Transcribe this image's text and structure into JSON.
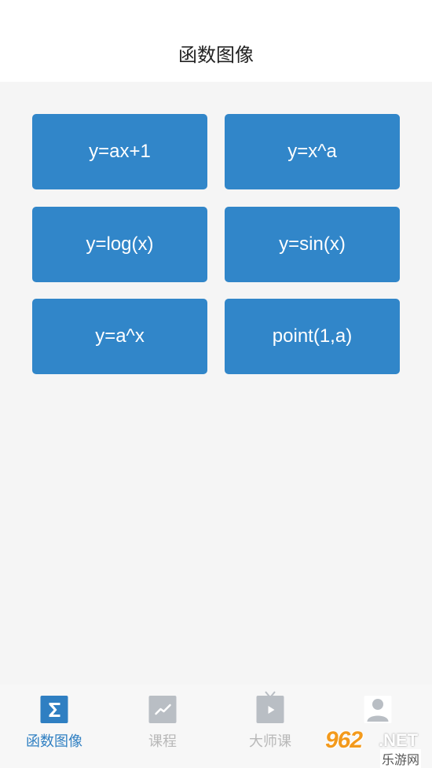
{
  "header": {
    "title": "函数图像"
  },
  "functions": [
    {
      "label": "y=ax+1"
    },
    {
      "label": "y=x^a"
    },
    {
      "label": "y=log(x)"
    },
    {
      "label": "y=sin(x)"
    },
    {
      "label": "y=a^x"
    },
    {
      "label": "point(1,a)"
    }
  ],
  "tabbar": {
    "tabs": [
      {
        "label": "函数图像",
        "icon": "sigma-icon",
        "active": true
      },
      {
        "label": "课程",
        "icon": "chart-icon",
        "active": false
      },
      {
        "label": "大师课",
        "icon": "tv-play-icon",
        "active": false
      },
      {
        "label": "",
        "icon": "user-icon",
        "active": false
      }
    ]
  },
  "watermark": {
    "number": "962",
    "suffix": ".NET",
    "caption": "乐游网"
  },
  "colors": {
    "accent": "#3186c9",
    "tab_active": "#2f7fc2",
    "tab_inactive": "#b8b8b8",
    "background": "#f5f5f5"
  }
}
